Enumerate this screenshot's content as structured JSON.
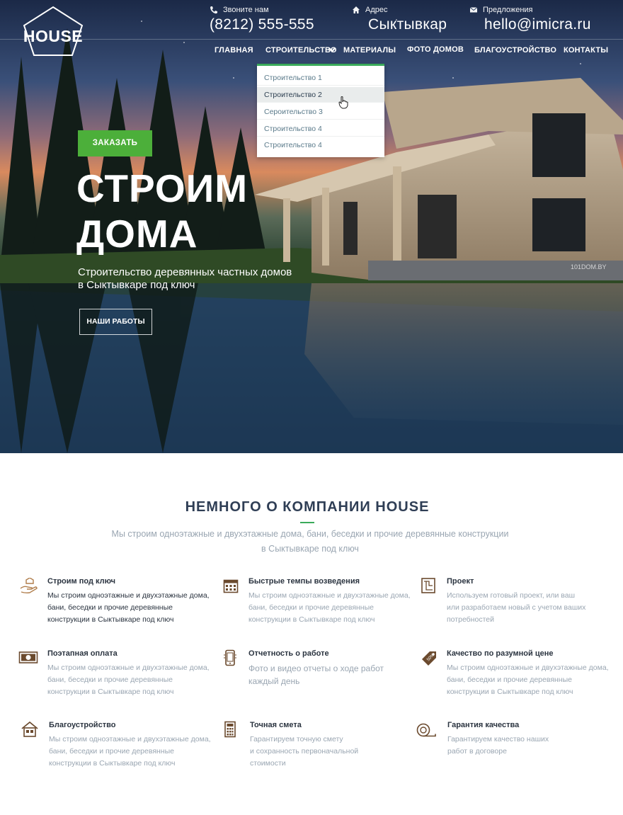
{
  "logo": {
    "text": "HOUSE"
  },
  "contacts": [
    {
      "label": "Звоните нам",
      "value": "(8212) 555-555",
      "icon": "phone-icon"
    },
    {
      "label": "Адрес",
      "value": "Сыктывкар",
      "icon": "home-icon"
    },
    {
      "label": "Предложения",
      "value": "hello@imicra.ru",
      "icon": "envelope-icon"
    }
  ],
  "nav": [
    "ГЛАВНАЯ",
    "СТРОИТЕЛЬСТВО",
    "МАТЕРИАЛЫ",
    "ФОТО ДОМОВ",
    "БЛАГОУСТРОЙСТВО",
    "КОНТАКТЫ"
  ],
  "dropdown": [
    "Строительство 1",
    "Строительство 2",
    "Сероительство 3",
    "Строительство 4",
    "Строительство 4"
  ],
  "hero": {
    "order_button": "ЗАКАЗАТЬ",
    "title_line1": "СТРОИМ",
    "title_line2": "ДОМА",
    "subtitle_line1": "Строительство деревянных частных домов",
    "subtitle_line2": "в Сыктывкаре под ключ",
    "works_button": "НАШИ РАБОТЫ",
    "watermark": "101DOM.BY"
  },
  "about": {
    "title": "НЕМНОГО О КОМПАНИИ HOUSE",
    "subtitle_line1": "Мы строим одноэтажные и двухэтажные дома, бани, беседки и прочие деревянные конструкции",
    "subtitle_line2": "в Сыктывкаре под ключ"
  },
  "features": [
    {
      "title": "Строим под ключ",
      "lines": [
        "Мы строим одноэтажные и двухэтажные дома,",
        "бани, беседки и прочие деревянные",
        "конструкции в Сыктывкаре под ключ"
      ],
      "icon": "hand-house-icon"
    },
    {
      "title": "Быстрые темпы возведения",
      "lines": [
        "Мы строим одноэтажные и двухэтажные дома,",
        "бани, беседки и прочие деревянные",
        "конструкции в Сыктывкаре под ключ"
      ],
      "icon": "calendar-icon"
    },
    {
      "title": "Проект",
      "lines": [
        "Используем готовый проект, или ваш",
        "или разработаем новый с учетом ваших",
        "потребностей"
      ],
      "icon": "blueprint-icon"
    },
    {
      "title": "Поэтапная оплата",
      "lines": [
        "Мы строим одноэтажные и двухэтажные дома,",
        "бани, беседки и прочие деревянные",
        "конструкции в Сыктывкаре под ключ"
      ],
      "icon": "money-icon"
    },
    {
      "title": "Отчетность о работе",
      "lines": [
        "Фото и видео отчеты о ходе работ",
        "каждый день"
      ],
      "icon": "smartphone-icon"
    },
    {
      "title": "Качество по разумной цене",
      "lines": [
        "Мы строим одноэтажные и двухэтажные дома,",
        "бани, беседки и прочие деревянные",
        "конструкции в Сыктывкаре под ключ"
      ],
      "icon": "price-tag-icon"
    },
    {
      "title": "Благоустройство",
      "lines": [
        "Мы строим одноэтажные и двухэтажные дома,",
        "бани, беседки и прочие деревянные",
        "конструкции в Сыктывкаре под ключ"
      ],
      "icon": "house-icon"
    },
    {
      "title": "Точная смета",
      "lines": [
        "Гарантируем точную смету",
        "и сохранность первоначальной",
        "стоимости"
      ],
      "icon": "calculator-icon"
    },
    {
      "title": "Гарантия качества",
      "lines": [
        "Гарантируем качество наших",
        "работ в договоре"
      ],
      "icon": "tape-measure-icon"
    }
  ],
  "colors": {
    "accent_green": "#4caf3a",
    "heading": "#2f3e55",
    "muted": "#9aa6b2"
  }
}
